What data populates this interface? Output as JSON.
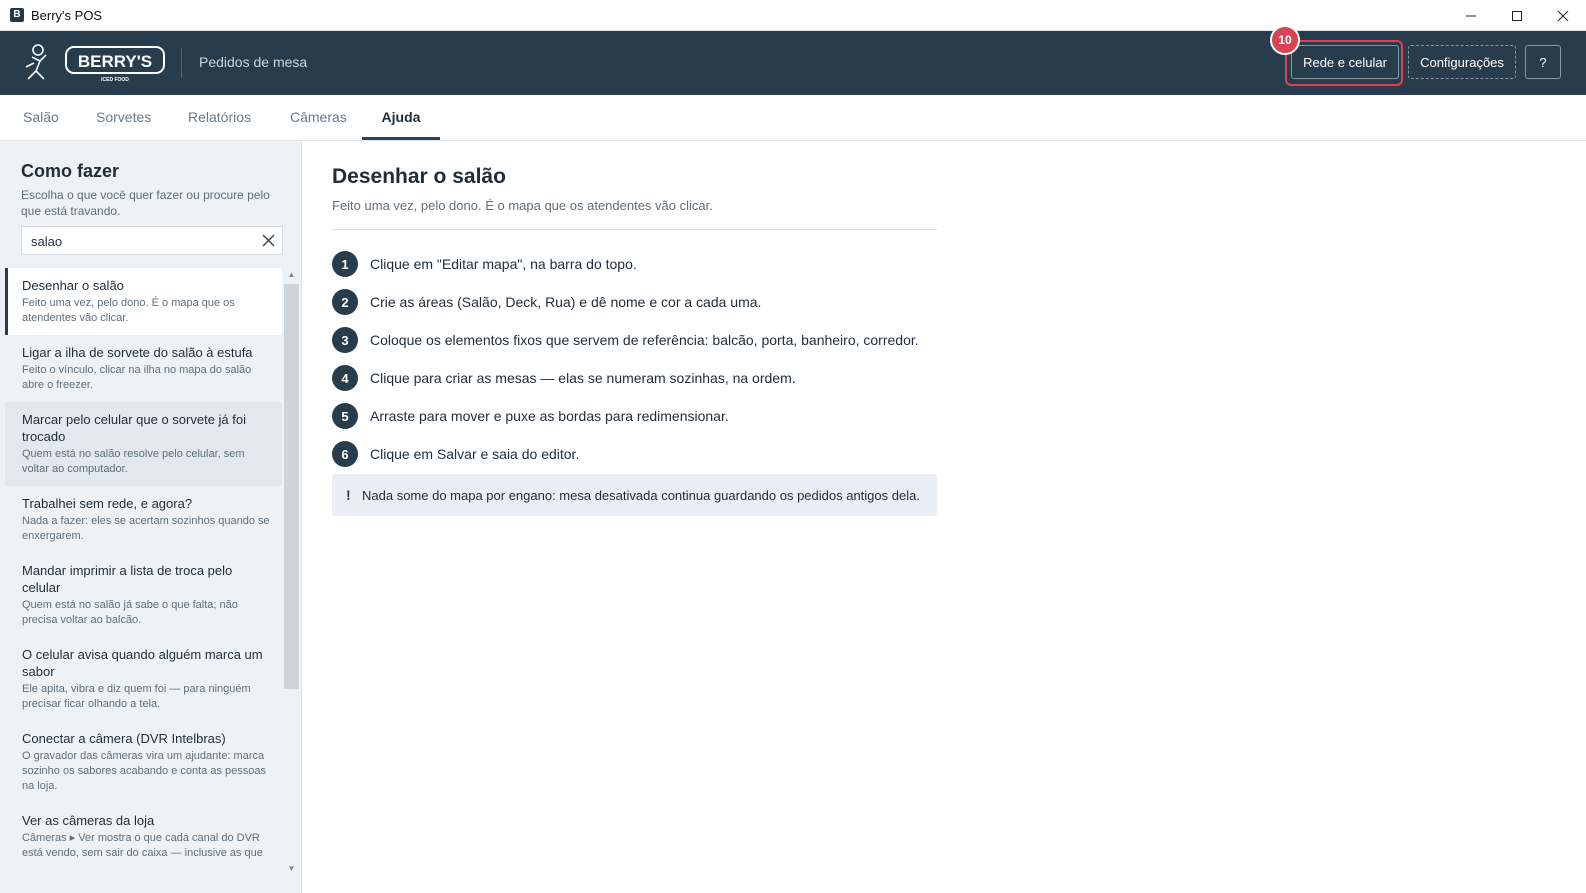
{
  "window": {
    "title": "Berry's POS"
  },
  "header": {
    "subtitle": "Pedidos de mesa",
    "logo_text": "BERRY'S",
    "logo_tagline": "ICED FOOD",
    "buttons": {
      "network": "Rede e celular",
      "settings": "Configurações",
      "help": "?"
    },
    "badge": "10"
  },
  "tabs": [
    "Salão",
    "Sorvetes",
    "Relatórios",
    "Câmeras",
    "Ajuda"
  ],
  "active_tab": "Ajuda",
  "sidebar": {
    "title": "Como fazer",
    "description": "Escolha o que você quer fazer ou procure pelo que está travando.",
    "search": {
      "value": "salao"
    },
    "items": [
      {
        "title": "Desenhar o salão",
        "desc": "Feito uma vez, pelo dono. É o mapa que os atendentes vão clicar."
      },
      {
        "title": "Ligar a ilha de sorvete do salão à estufa",
        "desc": "Feito o vínculo, clicar na ilha no mapa do salão abre o freezer."
      },
      {
        "title": "Marcar pelo celular que o sorvete já foi trocado",
        "desc": "Quem está no salão resolve pelo celular, sem voltar ao computador."
      },
      {
        "title": "Trabalhei sem rede, e agora?",
        "desc": "Nada a fazer: eles se acertam sozinhos quando se enxergarem."
      },
      {
        "title": "Mandar imprimir a lista de troca pelo celular",
        "desc": "Quem está no salão já sabe o que falta; não precisa voltar ao balcão."
      },
      {
        "title": "O celular avisa quando alguém marca um sabor",
        "desc": "Ele apita, vibra e diz quem foi — para ninguém precisar ficar olhando a tela."
      },
      {
        "title": "Conectar a câmera (DVR Intelbras)",
        "desc": "O gravador das câmeras vira um ajudante: marca sozinho os sabores acabando e conta as pessoas na loja."
      },
      {
        "title": "Ver as câmeras da loja",
        "desc": "Câmeras ▸ Ver mostra o que cada canal do DVR está vendo, sem sair do caixa — inclusive as que"
      }
    ]
  },
  "content": {
    "title": "Desenhar o salão",
    "subtitle": "Feito uma vez, pelo dono. É o mapa que os atendentes vão clicar.",
    "steps": [
      {
        "n": "1",
        "text": "Clique em \"Editar mapa\", na barra do topo."
      },
      {
        "n": "2",
        "text": "Crie as áreas (Salão, Deck, Rua) e dê nome e cor a cada uma."
      },
      {
        "n": "3",
        "text": "Coloque os elementos fixos que servem de referência: balcão, porta, banheiro, corredor."
      },
      {
        "n": "4",
        "text": "Clique para criar as mesas — elas se numeram sozinhas, na ordem."
      },
      {
        "n": "5",
        "text": "Arraste para mover e puxe as bordas para redimensionar."
      },
      {
        "n": "6",
        "text": "Clique em Salvar e saia do editor."
      }
    ],
    "note": {
      "icon": "!",
      "text": "Nada some do mapa por engano: mesa desativada continua guardando os pedidos antigos dela."
    }
  },
  "colors": {
    "header_bg": "#273c4d",
    "accent_red": "#d94452",
    "sidebar_bg": "#eef2f5"
  }
}
